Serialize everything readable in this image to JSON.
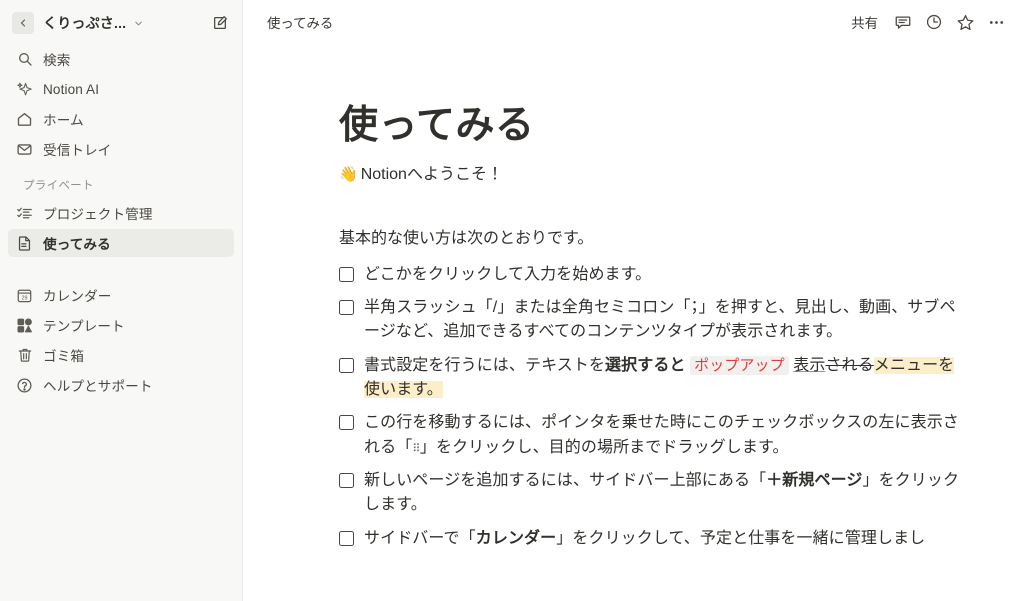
{
  "sidebar": {
    "workspace_name": "くりっぷさ...",
    "back_icon": "chevron-left-icon",
    "workspace_chevron_icon": "chevron-down-icon",
    "compose_icon": "compose-icon",
    "top_items": [
      {
        "icon": "search-icon",
        "label": "検索"
      },
      {
        "icon": "sparkle-ai-icon",
        "label": "Notion AI"
      },
      {
        "icon": "home-icon",
        "label": "ホーム"
      },
      {
        "icon": "inbox-icon",
        "label": "受信トレイ"
      }
    ],
    "private_section_label": "プライベート",
    "private_items": [
      {
        "icon": "checklist-icon",
        "label": "プロジェクト管理",
        "selected": false
      },
      {
        "icon": "document-icon",
        "label": "使ってみる",
        "selected": true
      }
    ],
    "bottom_items": [
      {
        "icon": "calendar-icon",
        "label": "カレンダー",
        "day": "29"
      },
      {
        "icon": "templates-icon",
        "label": "テンプレート"
      },
      {
        "icon": "trash-icon",
        "label": "ゴミ箱"
      },
      {
        "icon": "help-circle-icon",
        "label": "ヘルプとサポート"
      }
    ]
  },
  "topbar": {
    "breadcrumb": "使ってみる",
    "share_label": "共有",
    "comment_icon": "comment-icon",
    "history_icon": "clock-history-icon",
    "favorite_icon": "star-icon",
    "more_icon": "more-horizontal-icon"
  },
  "page": {
    "title": "使ってみる",
    "welcome_emoji": "👋",
    "welcome_text": "Notionへようこそ！",
    "intro": "基本的な使い方は次のとおりです。",
    "todos": [
      {
        "id": "todo-click-to-type",
        "checked": false,
        "segments": [
          {
            "text": "どこかをクリックして入力を始めます。",
            "style": "plain"
          }
        ]
      },
      {
        "id": "todo-slash-command",
        "checked": false,
        "segments": [
          {
            "text": "半角スラッシュ「/」または全角セミコロン「；」を押すと、見出し、動画、サブページなど、追加できるすべてのコンテンツタイプが表示されます。",
            "style": "plain"
          }
        ]
      },
      {
        "id": "todo-formatting-popup",
        "checked": false,
        "segments": [
          {
            "text": "書式設定を行うには、テキストを",
            "style": "plain"
          },
          {
            "text": "選択すると",
            "style": "bold"
          },
          {
            "text": " ",
            "style": "plain"
          },
          {
            "text": "ポップアップ",
            "style": "code"
          },
          {
            "text": " ",
            "style": "plain"
          },
          {
            "text": "表示",
            "style": "underline"
          },
          {
            "text": "される",
            "style": "strikethrough"
          },
          {
            "text": "メニューを使います。",
            "style": "highlight"
          }
        ]
      },
      {
        "id": "todo-drag-to-move",
        "checked": false,
        "segments": [
          {
            "text": "この行を移動するには、ポインタを乗せた時にこのチェックボックスの左に表示される「",
            "style": "plain"
          },
          {
            "text": "⠿",
            "style": "drag-dots"
          },
          {
            "text": "」をクリックし、目的の場所までドラッグします。",
            "style": "plain"
          }
        ]
      },
      {
        "id": "todo-new-page",
        "checked": false,
        "segments": [
          {
            "text": "新しいページを追加するには、サイドバー上部にある「",
            "style": "plain"
          },
          {
            "text": "＋新規ページ",
            "style": "bold"
          },
          {
            "text": "」をクリックします。",
            "style": "plain"
          }
        ]
      },
      {
        "id": "todo-calendar",
        "checked": false,
        "segments": [
          {
            "text": "サイドバーで「",
            "style": "plain"
          },
          {
            "text": "カレンダー",
            "style": "bold"
          },
          {
            "text": "」をクリックして、予定と仕事を一緒に管理しまし",
            "style": "plain"
          }
        ]
      }
    ]
  },
  "colors": {
    "sidebar_bg": "#f8f8f6",
    "selected_bg": "#ebebe8",
    "text_primary": "#32302c",
    "text_secondary": "#4b4843",
    "text_muted": "#91908c",
    "code_red": "#e03e3e",
    "code_bg": "#f1f0ef",
    "highlight_yellow": "#fbeec9"
  }
}
